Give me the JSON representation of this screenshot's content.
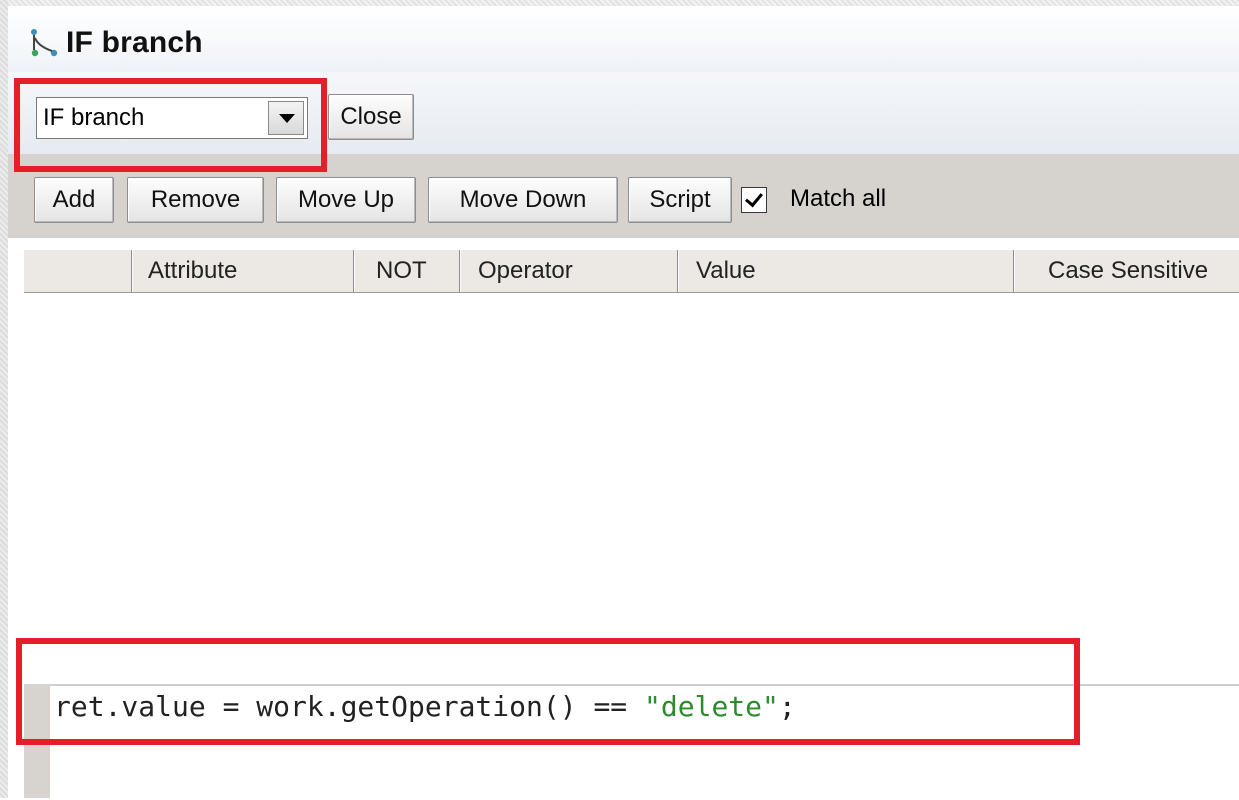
{
  "window": {
    "title": "IF branch",
    "icon": "branch-node-icon"
  },
  "top_toolbar": {
    "select": {
      "selected": "IF branch"
    },
    "close_label": "Close"
  },
  "action_bar": {
    "add_label": "Add",
    "remove_label": "Remove",
    "move_up_label": "Move Up",
    "move_down_label": "Move Down",
    "script_label": "Script",
    "match_all": {
      "label": "Match all",
      "checked": true
    }
  },
  "table": {
    "columns": [
      "",
      "Attribute",
      "NOT",
      "Operator",
      "Value",
      "Case Sensitive"
    ],
    "rows": []
  },
  "script": {
    "code_prefix": "ret.value = work.getOperation() == ",
    "code_string": "\"delete\"",
    "code_suffix": ";"
  },
  "highlight_color": "#e3202a"
}
